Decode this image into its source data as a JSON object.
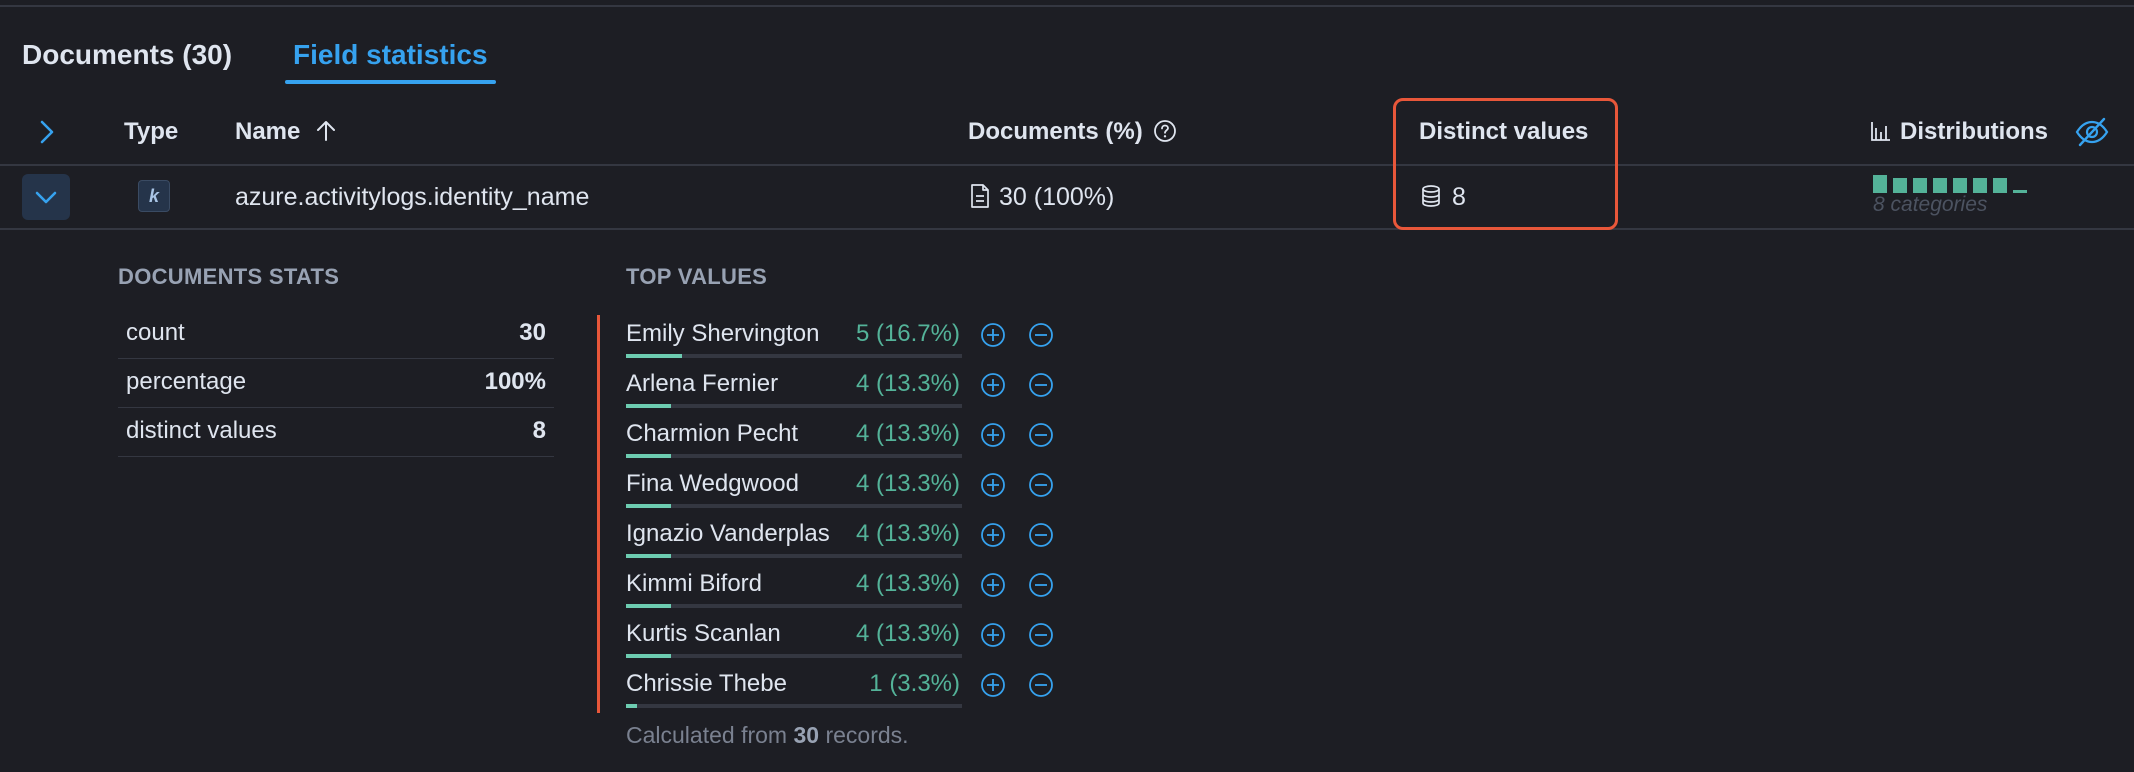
{
  "tabs": [
    {
      "label": "Documents (30)",
      "active": false
    },
    {
      "label": "Field statistics",
      "active": true
    }
  ],
  "columns": {
    "type": "Type",
    "name": "Name",
    "documents": "Documents (%)",
    "distinct": "Distinct values",
    "distributions": "Distributions"
  },
  "field": {
    "type_badge": "k",
    "name": "azure.activitylogs.identity_name",
    "documents": "30 (100%)",
    "distinct": "8",
    "distribution_caption": "8 categories"
  },
  "documents_stats": {
    "title": "DOCUMENTS STATS",
    "rows": [
      {
        "key": "count",
        "value": "30"
      },
      {
        "key": "percentage",
        "value": "100%"
      },
      {
        "key": "distinct values",
        "value": "8"
      }
    ]
  },
  "top_values": {
    "title": "TOP VALUES",
    "items": [
      {
        "name": "Emily Shervington",
        "pct": "5 (16.7%)",
        "fraction": 0.167
      },
      {
        "name": "Arlena Fernier",
        "pct": "4 (13.3%)",
        "fraction": 0.133
      },
      {
        "name": "Charmion Pecht",
        "pct": "4 (13.3%)",
        "fraction": 0.133
      },
      {
        "name": "Fina Wedgwood",
        "pct": "4 (13.3%)",
        "fraction": 0.133
      },
      {
        "name": "Ignazio Vanderplas",
        "pct": "4 (13.3%)",
        "fraction": 0.133
      },
      {
        "name": "Kimmi Biford",
        "pct": "4 (13.3%)",
        "fraction": 0.133
      },
      {
        "name": "Kurtis Scanlan",
        "pct": "4 (13.3%)",
        "fraction": 0.133
      },
      {
        "name": "Chrissie Thebe",
        "pct": "1 (3.3%)",
        "fraction": 0.033
      }
    ],
    "note_prefix": "Calculated from ",
    "note_count": "30",
    "note_suffix": " records."
  },
  "colors": {
    "accent_blue": "#36a2ef",
    "highlight": "#e8573a",
    "bar_green": "#54b399"
  }
}
